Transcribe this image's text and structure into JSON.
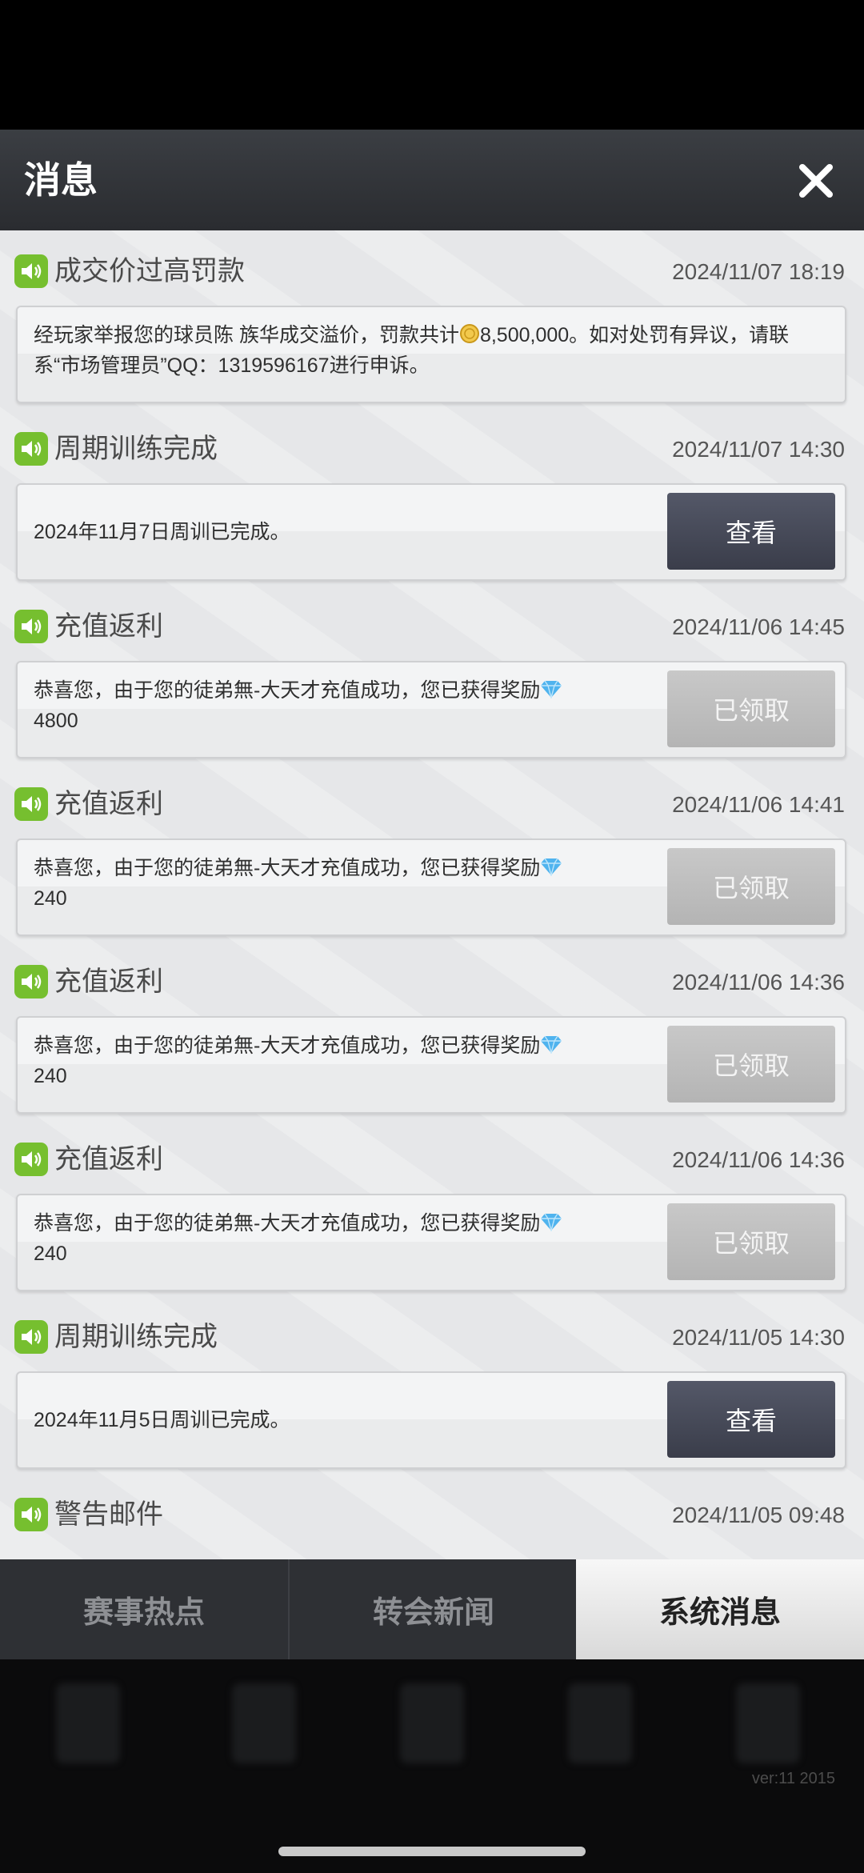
{
  "header": {
    "title": "消息"
  },
  "messages": [
    {
      "title": "成交价过高罚款",
      "date": "2024/11/07 18:19",
      "text_before": "经玩家举报您的球员陈 族华成交溢价，罚款共计",
      "text_after": "8,500,000。如对处罚有异议，请联系“市场管理员”QQ：1319596167进行申诉。"
    },
    {
      "title": "周期训练完成",
      "date": "2024/11/07 14:30",
      "text": "2024年11月7日周训已完成。",
      "button": "查看"
    },
    {
      "title": "充值返利",
      "date": "2024/11/06 14:45",
      "text": "恭喜您，由于您的徒弟無-大天才充值成功，您已获得奖励",
      "amount": "4800",
      "button": "已领取"
    },
    {
      "title": "充值返利",
      "date": "2024/11/06 14:41",
      "text": "恭喜您，由于您的徒弟無-大天才充值成功，您已获得奖励",
      "amount": "240",
      "button": "已领取"
    },
    {
      "title": "充值返利",
      "date": "2024/11/06 14:36",
      "text": "恭喜您，由于您的徒弟無-大天才充值成功，您已获得奖励",
      "amount": "240",
      "button": "已领取"
    },
    {
      "title": "充值返利",
      "date": "2024/11/06 14:36",
      "text": "恭喜您，由于您的徒弟無-大天才充值成功，您已获得奖励",
      "amount": "240",
      "button": "已领取"
    },
    {
      "title": "周期训练完成",
      "date": "2024/11/05 14:30",
      "text": "2024年11月5日周训已完成。",
      "button": "查看"
    },
    {
      "title": "警告邮件",
      "date": "2024/11/05 09:48"
    }
  ],
  "tabs": [
    {
      "label": "赛事热点"
    },
    {
      "label": "转会新闻"
    },
    {
      "label": "系统消息",
      "active": true
    }
  ],
  "footer": {
    "version": "ver:11  2015"
  },
  "colors": {
    "speaker": "#76bf2f",
    "view_button": "#454855",
    "claimed_button": "#bdbdbd",
    "active_tab": "#ececec"
  }
}
